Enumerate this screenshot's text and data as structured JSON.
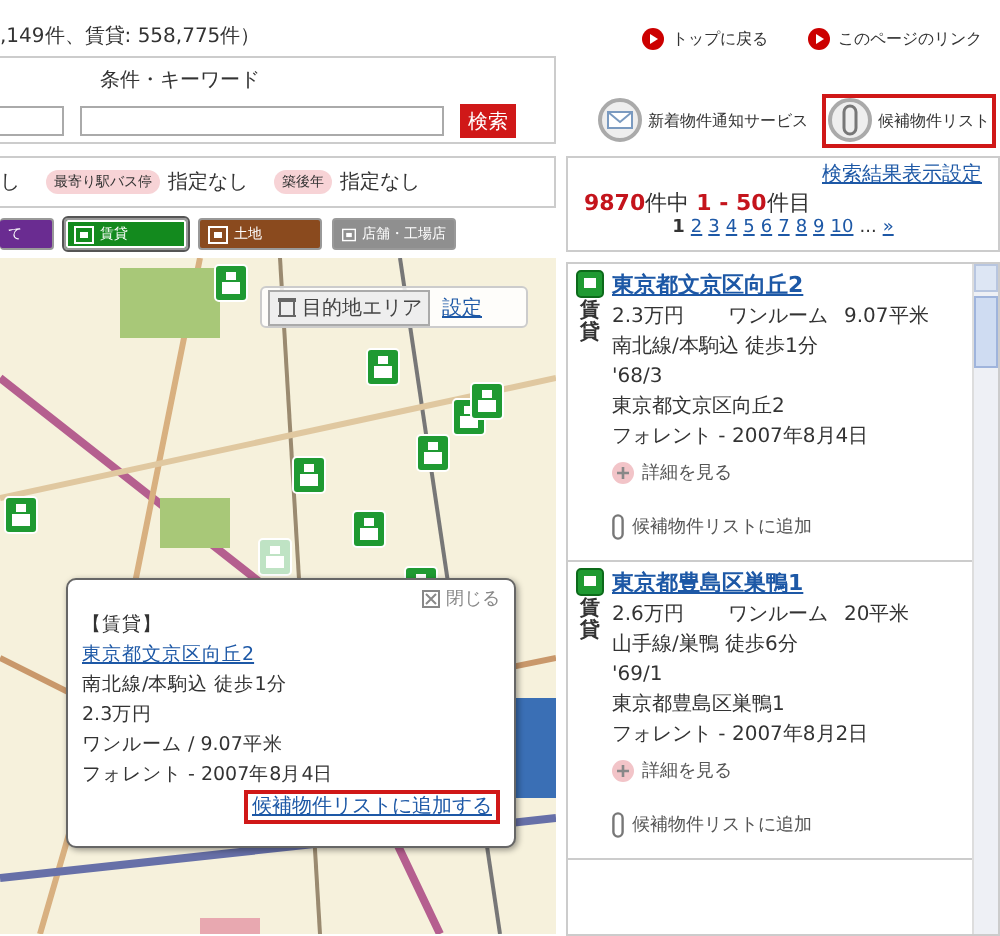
{
  "count_text": ",149件、賃貸: 558,775件）",
  "top_links": [
    "トップに戻る",
    "このページのリンク"
  ],
  "search": {
    "label": "条件・キーワード",
    "button": "検索"
  },
  "services": [
    {
      "kind": "mail",
      "label": "新着物件通知サービス",
      "highlighted": false
    },
    {
      "kind": "clip",
      "label": "候補物件リスト",
      "highlighted": true
    }
  ],
  "conditions": [
    {
      "value": "し"
    },
    {
      "badge": "最寄り駅バス停",
      "value": "指定なし"
    },
    {
      "badge": "築後年",
      "value": "指定なし"
    }
  ],
  "categories": [
    {
      "label": "て",
      "color": "#6a2c91",
      "selected": false
    },
    {
      "label": "賃貸",
      "color": "#138a1e",
      "selected": true
    },
    {
      "label": "土地",
      "color": "#8a4a1e",
      "selected": false
    },
    {
      "label": "店舗・工場店",
      "color": "#8f8f8f",
      "selected": false
    }
  ],
  "results": {
    "settings_link": "検索結果表示設定",
    "total": "9870",
    "total_suffix": "件中",
    "range": "1 - 50",
    "range_suffix": "件目",
    "pages": [
      {
        "label": "1",
        "selected": true
      },
      {
        "label": "2",
        "selected": false
      },
      {
        "label": "3",
        "selected": false
      },
      {
        "label": "4",
        "selected": false
      },
      {
        "label": "5",
        "selected": false
      },
      {
        "label": "6",
        "selected": false
      },
      {
        "label": "7",
        "selected": false
      },
      {
        "label": "8",
        "selected": false
      },
      {
        "label": "9",
        "selected": false
      },
      {
        "label": "10",
        "selected": false
      }
    ],
    "ellipsis": "...",
    "next": "»"
  },
  "map": {
    "area_button": "目的地エリア",
    "settings_link": "設定",
    "popup": {
      "close": "閉じる",
      "type": "【賃貸】",
      "title": "東京都文京区向丘2",
      "lines": [
        "南北線/本駒込 徒歩1分",
        "2.3万円",
        "ワンルーム / 9.07平米",
        "フォレント - 2007年8月4日"
      ],
      "add_link": "候補物件リストに追加する"
    }
  },
  "listings": [
    {
      "type": "賃貸",
      "title": "東京都文京区向丘2",
      "price": "2.3万円",
      "layout": "ワンルーム",
      "area": "9.07平米",
      "station": "南北線/本駒込 徒歩1分",
      "built": "'68/3",
      "address": "東京都文京区向丘2",
      "agent": "フォレント - 2007年8月4日",
      "details": "詳細を見る",
      "add": "候補物件リストに追加"
    },
    {
      "type": "賃貸",
      "title": "東京都豊島区巣鴨1",
      "price": "2.6万円",
      "layout": "ワンルーム",
      "area": "20平米",
      "station": "山手線/巣鴨 徒歩6分",
      "built": "'69/1",
      "address": "東京都豊島区巣鴨1",
      "agent": "フォレント - 2007年8月2日",
      "details": "詳細を見る",
      "add": "候補物件リストに追加"
    }
  ]
}
